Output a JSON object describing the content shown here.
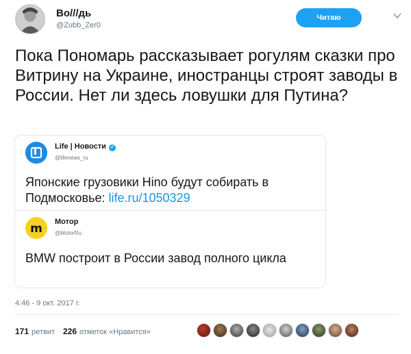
{
  "author": {
    "name": "Во///дь",
    "handle": "@Zubb_Zer0"
  },
  "follow_button": {
    "label": "Читаю"
  },
  "tweet_text": "Пока Пономарь рассказывает рогулям сказки про Витрину на Украине, иностранцы строят заводы в России. Нет ли здесь ловушки для Путина?",
  "quotes": [
    {
      "name": "Life | Новости",
      "handle": "@lifenews_ru",
      "text": "Японские грузовики Hino будут собирать в Подмосковье: ",
      "link": "life.ru/1050329",
      "verified": true
    },
    {
      "name": "Мотор",
      "handle": "@MotorRu",
      "text": "BMW построит в России завод полного цикла",
      "verified": false
    }
  ],
  "timestamp": "4:46 - 9 окт. 2017 г.",
  "stats": {
    "retweets_count": "171",
    "retweets_label": "ретвит",
    "likes_count": "226",
    "likes_label": "отметок «Нравится»"
  },
  "colors": {
    "accent": "#1da1f2",
    "link": "#1b95e0",
    "muted": "#657786",
    "border": "#e1e8ed"
  },
  "icons": [
    "avatar-image",
    "chevron-down-icon",
    "verified-badge-icon",
    "life-logo-icon",
    "motor-logo-icon"
  ]
}
